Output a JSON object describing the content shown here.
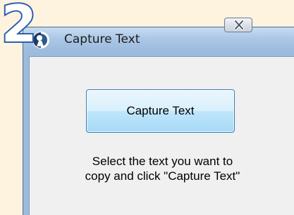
{
  "step": {
    "number": "2"
  },
  "window": {
    "title": "Capture Text",
    "icon": "app-logo-icon",
    "close_icon": "close-icon"
  },
  "main": {
    "capture_button_label": "Capture Text",
    "instruction_line1": "Select the text you want to",
    "instruction_line2": "copy and click \"Capture Text\""
  },
  "colors": {
    "page_background": "#fdf3df",
    "step_number_outline": "#2c5fae",
    "titlebar": "#aac6e5",
    "client_background": "#f0f0f0",
    "button_border": "#3c7fb1"
  }
}
